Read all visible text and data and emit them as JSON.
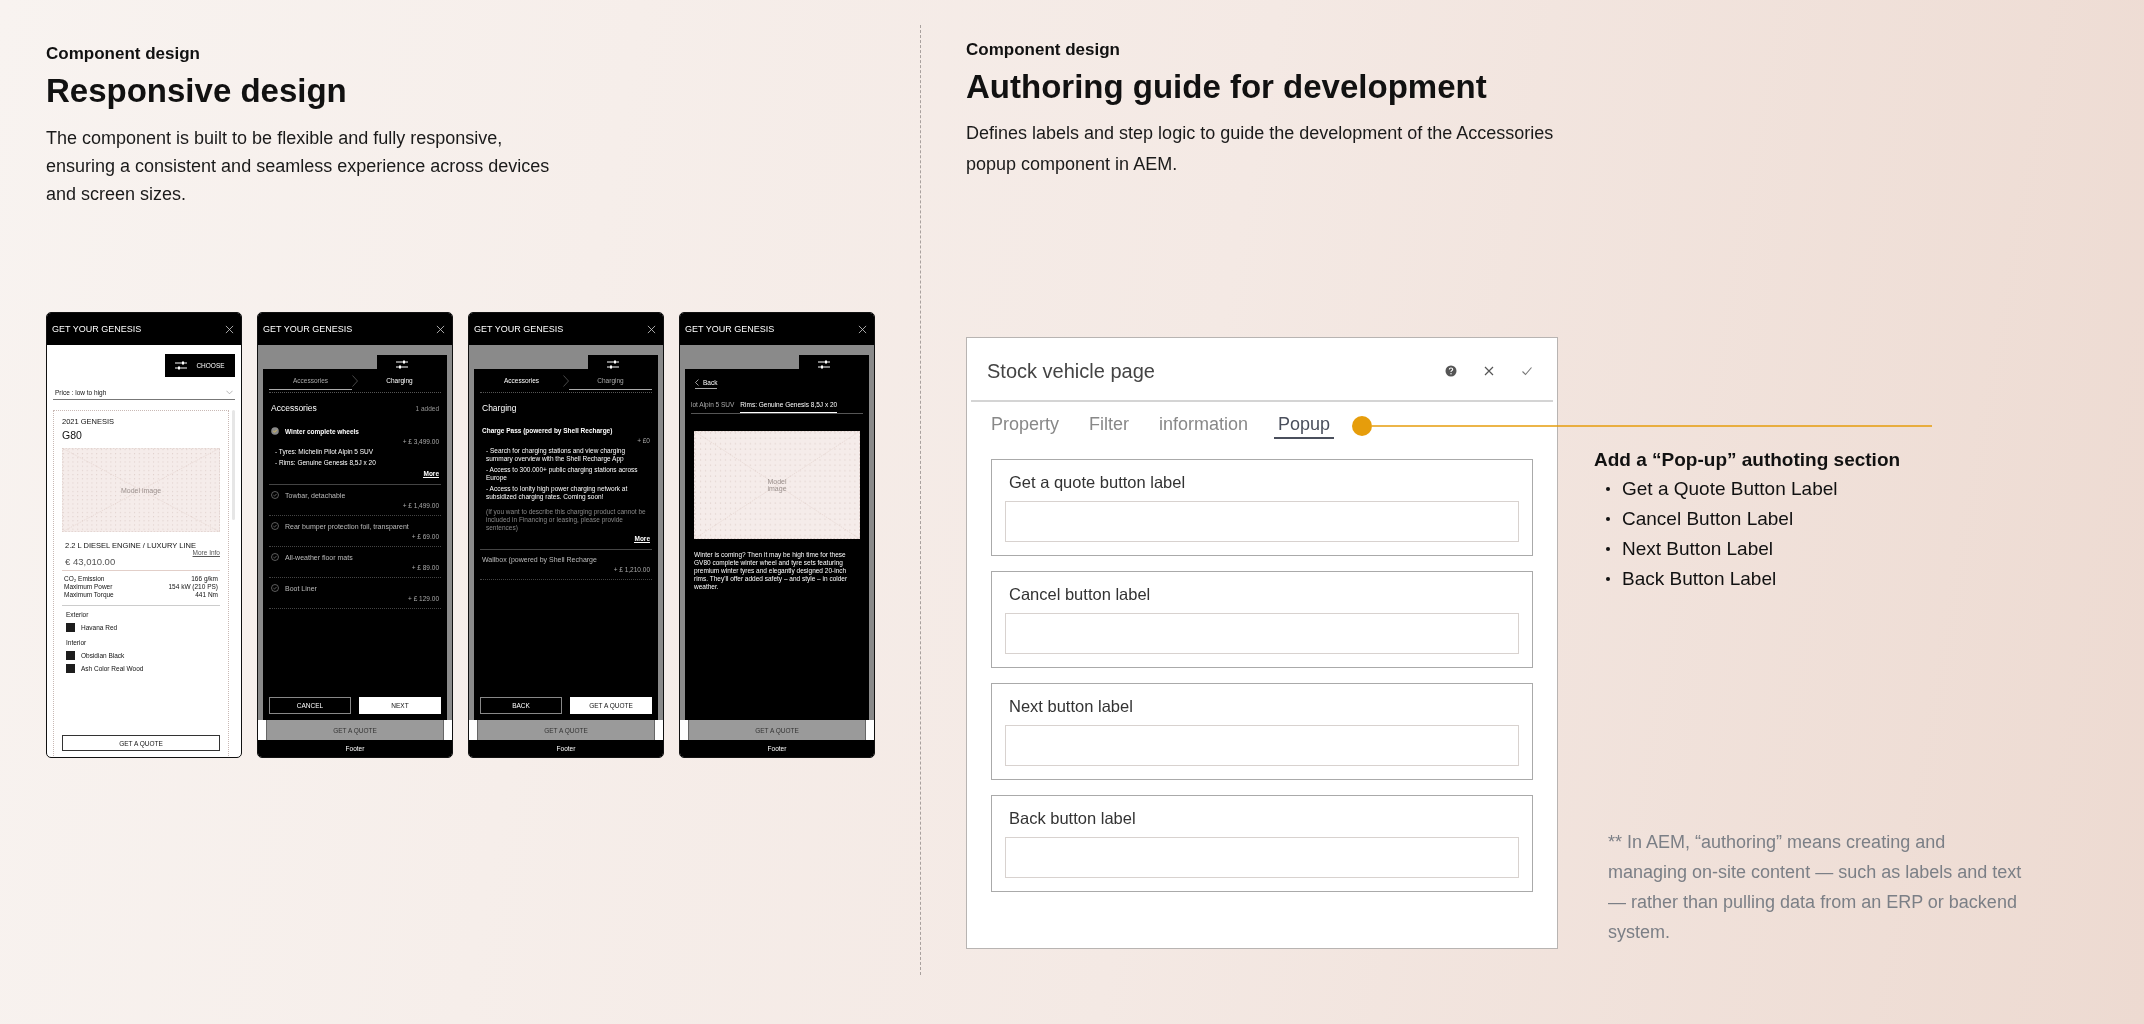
{
  "left": {
    "eyebrow": "Component design",
    "title": "Responsive design",
    "description": "The component is built to be flexible and fully responsive, ensuring a consistent and seamless experience across devices and screen sizes."
  },
  "phones": [
    {
      "kind": "results",
      "title": "GET YOUR GENESIS",
      "choose": "CHOOSE",
      "sort": "Price : low to high",
      "card": {
        "year": "2021 GENESIS",
        "model": "G80",
        "image": "Model image",
        "engine": "2.2 L DIESEL ENGINE / LUXURY LINE",
        "more": "More Info",
        "price": "€ 43,010.00",
        "specs": [
          {
            "label": "CO₂ Emission",
            "value": "166 g/km"
          },
          {
            "label": "Maximum Power",
            "value": "154 kW (210 PS)"
          },
          {
            "label": "Maximum Torque",
            "value": "441 Nm"
          }
        ],
        "exterior_label": "Exterior",
        "exterior": [
          "Havana Red"
        ],
        "interior_label": "Interior",
        "interior": [
          "Obsidian Black",
          "Ash Color Real Wood"
        ]
      },
      "button": "GET A QUOTE"
    },
    {
      "kind": "sheet",
      "title": "GET YOUR GENESIS",
      "steps": [
        {
          "label": "Accessories",
          "selected": true
        },
        {
          "label": "Charging",
          "selected": false
        }
      ],
      "heading": "Accessories",
      "count": "1 added",
      "items": [
        {
          "name": "Winter complete wheels",
          "price": "+ £ 3,499.00",
          "checked": true,
          "expanded": true,
          "details": [
            "- Tyres: Michelin Pilot Alpin 5 SUV",
            "- Rims: Genuine Genesis 8,5J x 20"
          ],
          "more": "More"
        },
        {
          "name": "Towbar, detachable",
          "price": "+ £ 1,499.00",
          "checked": false,
          "expanded": false
        },
        {
          "name": "Rear bumper protection foil, transparent",
          "price": "+ £ 69.00",
          "checked": false,
          "expanded": false
        },
        {
          "name": "All-weather floor mats",
          "price": "+ £ 89.00",
          "checked": false,
          "expanded": false
        },
        {
          "name": "Boot Liner",
          "price": "+ £ 129.00",
          "checked": false,
          "expanded": false
        }
      ],
      "buttons": [
        {
          "label": "CANCEL",
          "kind": "outline"
        },
        {
          "label": "NEXT",
          "kind": "primary"
        }
      ],
      "behind_button": "GET A QUOTE",
      "footer": "Footer"
    },
    {
      "kind": "sheet",
      "title": "GET YOUR GENESIS",
      "steps": [
        {
          "label": "Accessories",
          "selected": false
        },
        {
          "label": "Charging",
          "selected": true
        }
      ],
      "heading": "Charging",
      "items": [
        {
          "name": "Charge Pass (powered by Shell Recharge)",
          "price": "+ £0",
          "expanded": true,
          "details": [
            "- Search for charging stations and view charging summary overview with the Shell Recharge App",
            "- Access to 300.000+ public charging stations across Europe",
            "- Access to Ionity high power charging network at subsidized charging rates. Coming soon!"
          ],
          "note": "(If you want to describe this charging product cannot be included in Financing or leasing, please provide sentences)",
          "more": "More"
        },
        {
          "name": "Wallbox (powered by Shell Recharge",
          "price": "+ £ 1,210.00",
          "expanded": false
        }
      ],
      "buttons": [
        {
          "label": "BACK",
          "kind": "outline"
        },
        {
          "label": "GET A QUOTE",
          "kind": "primary"
        }
      ],
      "behind_button": "GET A QUOTE",
      "footer": "Footer"
    },
    {
      "kind": "detail",
      "title": "GET YOUR GENESIS",
      "back": "Back",
      "tabs": [
        {
          "label": "lot Alpin 5 SUV",
          "selected": false
        },
        {
          "label": "Rims: Genuine Genesis 8,5J x 20",
          "selected": true
        }
      ],
      "image": "Model image",
      "description": "Winter is coming? Then it may be high time for these GV80 complete winter wheel and tyre sets featuring premium winter tyres and elegantly designed 20-inch rims. They'll offer added safety – and style – in colder weather.",
      "behind_button": "GET A QUOTE",
      "footer": "Footer"
    }
  ],
  "right": {
    "eyebrow": "Component design",
    "title": "Authoring guide for development",
    "description": "Defines labels and step logic to guide the development of the Accessories popup component in AEM."
  },
  "dialog": {
    "title": "Stock vehicle page",
    "tabs": [
      {
        "label": "Property",
        "selected": false
      },
      {
        "label": "Filter",
        "selected": false
      },
      {
        "label": "information",
        "selected": false
      },
      {
        "label": "Popup",
        "selected": true
      }
    ],
    "fields": [
      {
        "label": "Get a quote button label"
      },
      {
        "label": "Cancel button label"
      },
      {
        "label": "Next button label"
      },
      {
        "label": "Back button label"
      }
    ]
  },
  "annotation": {
    "heading": "Add a “Pop-up” authoting section",
    "items": [
      "Get a Quote Button Label",
      "Cancel Button Label",
      "Next Button Label",
      "Back Button Label"
    ],
    "note": "** In AEM, “authoring” means creating and managing on-site content — such as labels and text — rather than pulling data from an ERP or backend system."
  }
}
